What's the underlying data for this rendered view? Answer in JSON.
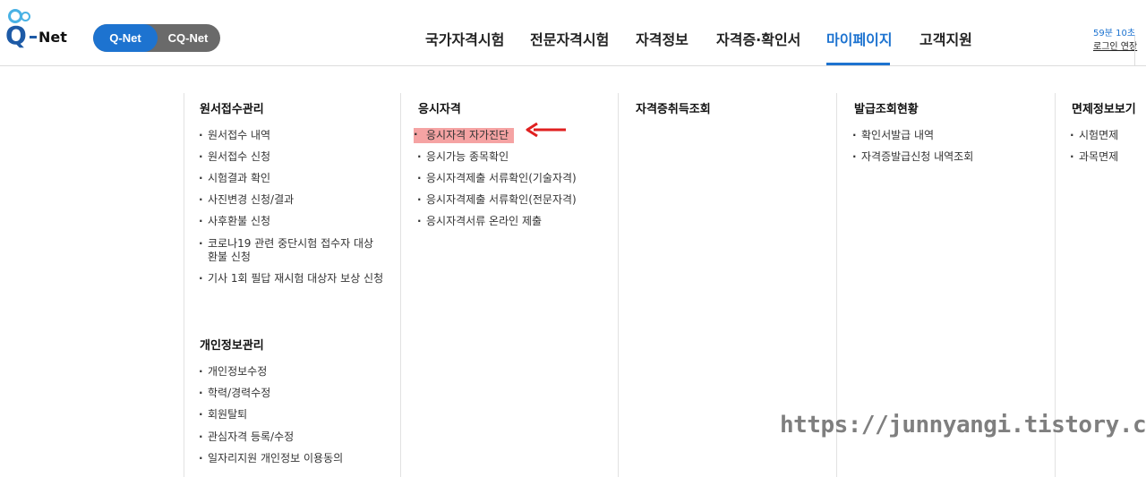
{
  "header": {
    "logo": {
      "q": "Q",
      "net": "Net"
    },
    "toggle": {
      "on": "Q-Net",
      "off": "CQ-Net"
    },
    "nav": [
      "국가자격시험",
      "전문자격시험",
      "자격정보",
      "자격증·확인서",
      "마이페이지",
      "고객지원"
    ],
    "active_nav": "마이페이지",
    "session": {
      "timer": "59분 10초",
      "extend": "로그인 연장"
    }
  },
  "menu": {
    "col1": {
      "title": "원서접수관리",
      "items": [
        "원서접수 내역",
        "원서접수 신청",
        "시험결과 확인",
        "사진변경 신청/결과",
        "사후환불 신청",
        "코로나19 관련 중단시험 접수자 대상",
        "환불 신청",
        "기사 1회 필답 재시험 대상자 보상 신청"
      ]
    },
    "col1b": {
      "title": "개인정보관리",
      "items": [
        "개인정보수정",
        "학력/경력수정",
        "회원탈퇴",
        "관심자격 등록/수정",
        "일자리지원 개인정보 이용동의"
      ]
    },
    "col2": {
      "title": "응시자격",
      "items": [
        "응시자격 자가진단",
        "응시가능 종목확인",
        "응시자격제출 서류확인(기술자격)",
        "응시자격제출 서류확인(전문자격)",
        "응시자격서류 온라인 제출"
      ]
    },
    "col3": {
      "title": "자격증취득조회"
    },
    "col4": {
      "title": "발급조회현황",
      "items": [
        "확인서발급 내역",
        "자격증발급신청 내역조회"
      ]
    },
    "col5": {
      "title": "면제정보보기",
      "items": [
        "시험면제",
        "과목면제"
      ]
    }
  },
  "annotation": {
    "highlight_color": "#f5a3a3",
    "arrow_color": "#e02020"
  },
  "watermark": "https://junnyangi.tistory.com"
}
